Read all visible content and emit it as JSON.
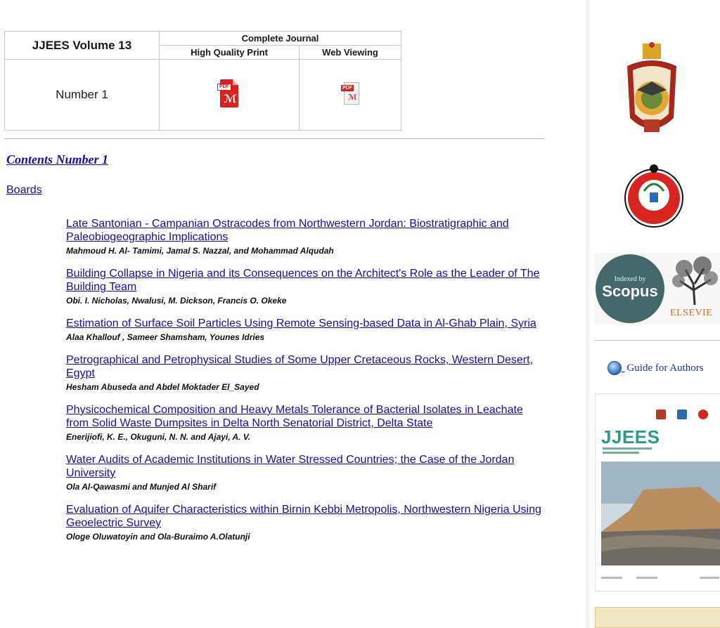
{
  "journal_table": {
    "volume_title": "JJEES Volume 13",
    "complete_journal": "Complete Journal",
    "high_quality_print": "High Quality Print",
    "web_viewing": "Web Viewing",
    "number_label": "Number 1",
    "pdf_print_icon": "pdf-icon",
    "pdf_web_icon": "pdf-icon"
  },
  "contents_link": "Contents Number 1",
  "boards_link": "Boards",
  "articles": [
    {
      "title": "Late Santonian - Campanian Ostracodes from Northwestern Jordan: Biostratigraphic and Paleobiogeographic Implications",
      "authors": "Mahmoud H. Al- Tamimi, Jamal S. Nazzal, and Mohammad Alqudah"
    },
    {
      "title": "Building Collapse in Nigeria and its Consequences on the Architect's Role as the Leader of The Building Team",
      "authors": "Obi. I. Nicholas, Nwalusi, M. Dickson, Francis O. Okeke"
    },
    {
      "title": "Estimation of Surface Soil Particles Using Remote Sensing-based Data in Al-Ghab Plain, Syria",
      "authors": "Alaa Khallouf , Sameer Shamsham, Younes Idries"
    },
    {
      "title": "Petrographical and Petrophysical Studies of Some Upper Cretaceous Rocks, Western Desert, Egypt",
      "authors": "Hesham Abuseda and Abdel Moktader El_Sayed"
    },
    {
      "title": "Physicochemical Composition and Heavy Metals Tolerance of Bacterial Isolates in Leachate from Solid Waste Dumpsites in Delta North Senatorial District, Delta State",
      "authors": "Enerijiofi, K. E., Okuguni, N. N. and Ajayi, A. V."
    },
    {
      "title": "Water Audits of Academic Institutions in Water Stressed Countries; the Case of the Jordan University",
      "authors": "Ola Al-Qawasmi and Munjed Al Sharif"
    },
    {
      "title": "Evaluation of Aquifer Characteristics within Birnin Kebbi Metropolis, Northwestern Nigeria Using Geoelectric Survey",
      "authors": "Ologe Oluwatoyin and Ola-Buraimo A.Olatunji"
    }
  ],
  "sidebar": {
    "coat_of_arms_icon": "jordan-coat-of-arms-icon",
    "university_seal_icon": "university-seal-icon",
    "scopus_indexed_by": "Indexed by",
    "scopus_label": "Scopus",
    "elsevier_label": "ELSEVIE",
    "guide_label": "Guide for Authors",
    "cover_title": "JJEES"
  },
  "colors": {
    "link": "#1a0dab",
    "pdf_red": "#d9201b",
    "scopus_teal": "#42686b",
    "cover_teal": "#2a9a8c"
  }
}
